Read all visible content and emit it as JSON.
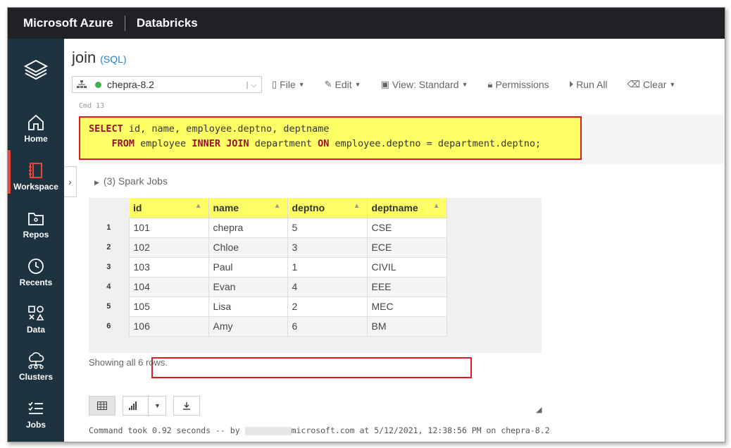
{
  "header": {
    "brand": "Microsoft Azure",
    "product": "Databricks"
  },
  "sidebar": {
    "items": [
      {
        "label": "",
        "icon": "layers-icon"
      },
      {
        "label": "Home",
        "icon": "home-icon"
      },
      {
        "label": "Workspace",
        "icon": "workspace-icon"
      },
      {
        "label": "Repos",
        "icon": "repos-icon"
      },
      {
        "label": "Recents",
        "icon": "clock-icon"
      },
      {
        "label": "Data",
        "icon": "data-icon"
      },
      {
        "label": "Clusters",
        "icon": "clusters-icon"
      },
      {
        "label": "Jobs",
        "icon": "jobs-icon"
      }
    ],
    "active": "Workspace"
  },
  "notebook": {
    "title": "join",
    "language": "(SQL)"
  },
  "toolbar": {
    "cluster": "chepra-8.2",
    "file": "File",
    "edit": "Edit",
    "view": "View: Standard",
    "permissions": "Permissions",
    "run_all": "Run All",
    "clear": "Clear"
  },
  "cell": {
    "label": "Cmd 13",
    "line1_kw": "SELECT",
    "line1_rest": " id, name, employee.deptno, deptname",
    "line2_indent": "    ",
    "line2_kw1": "FROM",
    "line2_mid1": " employee ",
    "line2_kw2": "INNER JOIN",
    "line2_mid2": " department ",
    "line2_kw3": "ON",
    "line2_rest": " employee.deptno = department.deptno;"
  },
  "spark_jobs": "(3) Spark Jobs",
  "table": {
    "columns": [
      "id",
      "name",
      "deptno",
      "deptname"
    ],
    "rows": [
      {
        "n": "1",
        "id": "101",
        "name": "chepra",
        "deptno": "5",
        "deptname": "CSE"
      },
      {
        "n": "2",
        "id": "102",
        "name": "Chloe",
        "deptno": "3",
        "deptname": "ECE"
      },
      {
        "n": "3",
        "id": "103",
        "name": "Paul",
        "deptno": "1",
        "deptname": "CIVIL"
      },
      {
        "n": "4",
        "id": "104",
        "name": "Evan",
        "deptno": "4",
        "deptname": "EEE"
      },
      {
        "n": "5",
        "id": "105",
        "name": "Lisa",
        "deptno": "2",
        "deptname": "MEC"
      },
      {
        "n": "6",
        "id": "106",
        "name": "Amy",
        "deptno": "6",
        "deptname": "BM"
      }
    ]
  },
  "showing": "Showing all 6 rows.",
  "command_took": {
    "prefix": "Command took 0.92 seconds -- by ",
    "suffix": "microsoft.com at 5/12/2021, 12:38:56 PM on chepra-8.2"
  },
  "colors": {
    "highlight": "#ffff66",
    "outline": "#e01b24",
    "sidebar": "#1e3340",
    "topbar": "#1f2126"
  }
}
